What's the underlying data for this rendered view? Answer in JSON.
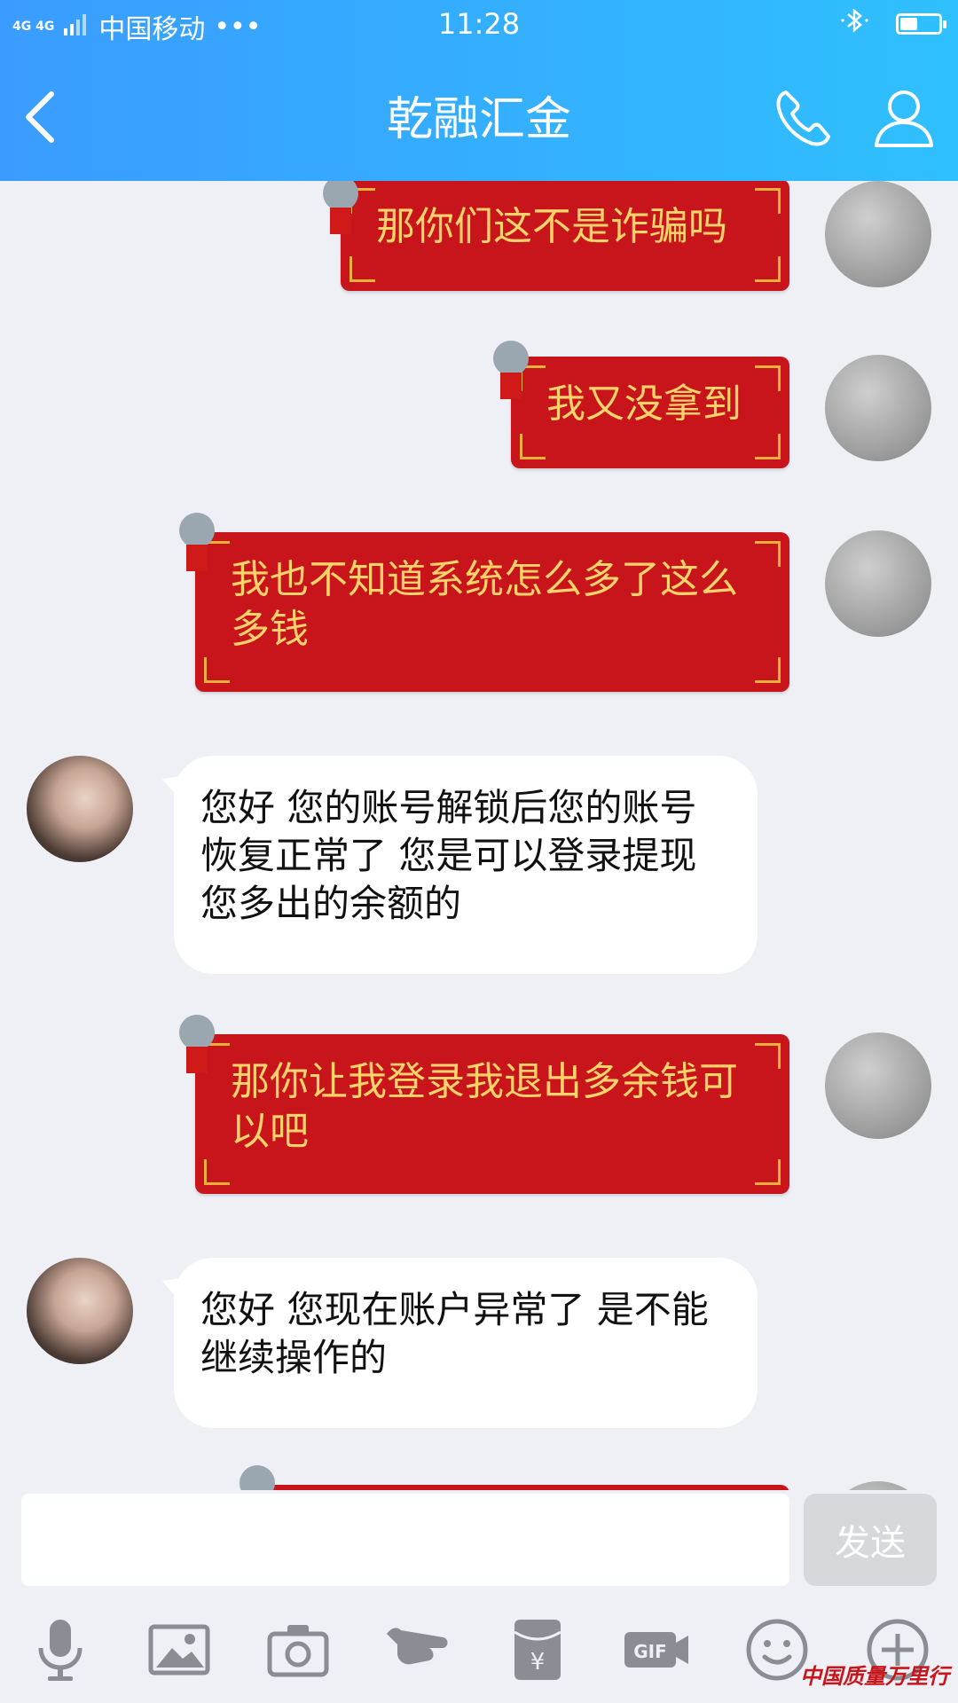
{
  "status_bar": {
    "network": "4G 4G",
    "carrier": "中国移动",
    "more": "•••",
    "time": "11:28",
    "battery_level": 0.45
  },
  "header": {
    "title": "乾融汇金"
  },
  "messages": [
    {
      "sender": "me",
      "text": "那你们这不是诈骗吗"
    },
    {
      "sender": "me",
      "text": "我又没拿到"
    },
    {
      "sender": "me",
      "text": "我也不知道系统怎么多了这么多钱"
    },
    {
      "sender": "other",
      "text": "您好 您的账号解锁后您的账号恢复正常了 您是可以登录提现 您多出的余额的"
    },
    {
      "sender": "me",
      "text": "那你让我登录我退出多余钱可以吧"
    },
    {
      "sender": "other",
      "text": "您好 您现在账户异常了 是不能继续操作的"
    }
  ],
  "input": {
    "value": "",
    "send_label": "发送"
  },
  "toolbar": {
    "items": [
      "microphone-icon",
      "image-icon",
      "camera-icon",
      "poke-icon",
      "red-packet-icon",
      "gif-icon",
      "emoji-icon",
      "plus-icon"
    ]
  },
  "watermark": "中国质量万里行",
  "colors": {
    "header_start": "#3a9cff",
    "header_end": "#2fc0ff",
    "red_bubble": "#c8151b",
    "red_bubble_text": "#ffd36b",
    "background": "#eef0f6"
  }
}
